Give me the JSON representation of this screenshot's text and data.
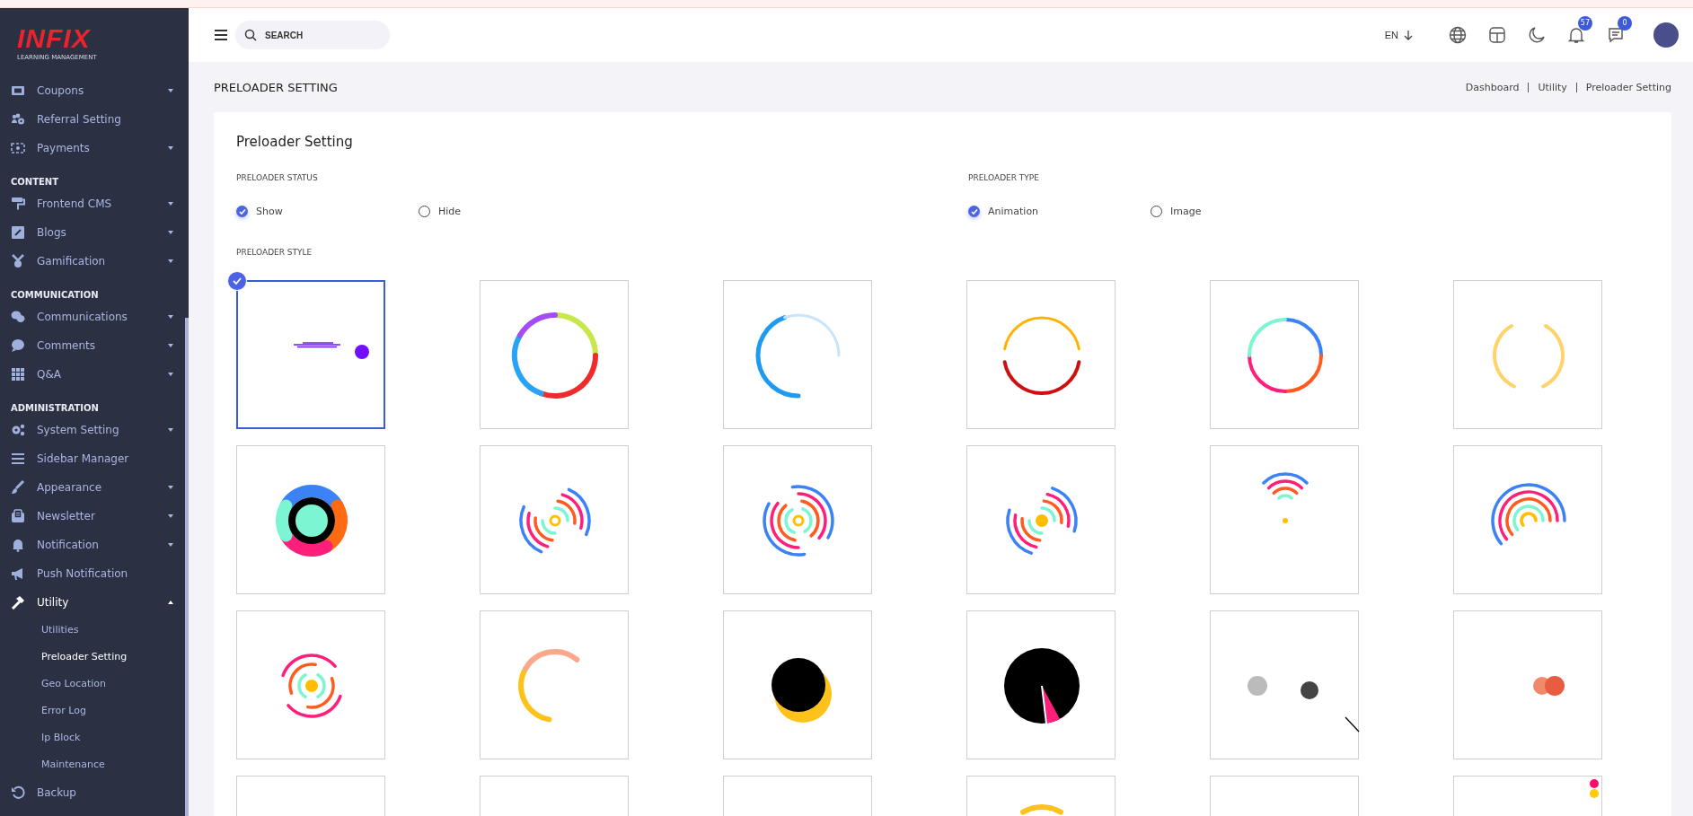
{
  "logo": {
    "wordmark": "INFIX",
    "tagline": "LEARNING MANAGEMENT"
  },
  "sidebar": {
    "sections": [
      {
        "items": [
          {
            "label": "Coupons",
            "expanded": false
          },
          {
            "label": "Referral Setting"
          },
          {
            "label": "Payments",
            "expanded": false
          }
        ]
      },
      {
        "title": "CONTENT",
        "items": [
          {
            "label": "Frontend CMS",
            "expanded": false
          },
          {
            "label": "Blogs",
            "expanded": false
          },
          {
            "label": "Gamification",
            "expanded": false
          }
        ]
      },
      {
        "title": "COMMUNICATION",
        "items": [
          {
            "label": "Communications",
            "expanded": false
          },
          {
            "label": "Comments",
            "expanded": false
          },
          {
            "label": "Q&A",
            "expanded": false
          }
        ]
      },
      {
        "title": "ADMINISTRATION",
        "items": [
          {
            "label": "System Setting",
            "expanded": false
          },
          {
            "label": "Sidebar Manager"
          },
          {
            "label": "Appearance",
            "expanded": false
          },
          {
            "label": "Newsletter",
            "expanded": false
          },
          {
            "label": "Notification",
            "expanded": false
          },
          {
            "label": "Push Notification"
          },
          {
            "label": "Utility",
            "expanded": true,
            "children": [
              {
                "label": "Utilities",
                "selected": false
              },
              {
                "label": "Preloader Setting",
                "selected": true
              },
              {
                "label": "Geo Location",
                "selected": false
              },
              {
                "label": "Error Log",
                "selected": false
              },
              {
                "label": "Ip Block",
                "selected": false
              },
              {
                "label": "Maintenance",
                "selected": false
              }
            ]
          },
          {
            "label": "Backup"
          }
        ]
      }
    ]
  },
  "header": {
    "search": {
      "placeholder": "SEARCH"
    },
    "language": "EN",
    "notifications_badge": "57",
    "messages_badge": "0"
  },
  "page": {
    "title": "PRELOADER SETTING",
    "breadcrumb": [
      "Dashboard",
      "Utility",
      "Preloader Setting"
    ]
  },
  "card": {
    "title": "Preloader Setting",
    "groups": [
      {
        "label": "PRELOADER STATUS",
        "options": [
          {
            "label": "Show",
            "selected": true
          },
          {
            "label": "Hide",
            "selected": false
          }
        ]
      },
      {
        "label": "PRELOADER TYPE",
        "options": [
          {
            "label": "Animation",
            "selected": true
          },
          {
            "label": "Image",
            "selected": false
          }
        ]
      }
    ],
    "style_label": "PRELOADER STYLE",
    "styles": [
      {
        "kind": "dash-blob",
        "selected": true
      },
      {
        "kind": "ring-rainbow",
        "selected": false
      },
      {
        "kind": "ring-blue",
        "selected": false
      },
      {
        "kind": "ring-sunset",
        "selected": false
      },
      {
        "kind": "ring-neon",
        "selected": false
      },
      {
        "kind": "arc-pair",
        "selected": false
      },
      {
        "kind": "donut",
        "selected": false
      },
      {
        "kind": "arcs-twin",
        "selected": false
      },
      {
        "kind": "arcs-ring",
        "selected": false
      },
      {
        "kind": "arcs-twin-dot",
        "selected": false
      },
      {
        "kind": "arcs-fan",
        "selected": false
      },
      {
        "kind": "arcs-rainbow",
        "selected": false
      },
      {
        "kind": "arcs-orbit",
        "selected": false
      },
      {
        "kind": "arc-single",
        "selected": false
      },
      {
        "kind": "eclipse",
        "selected": false
      },
      {
        "kind": "pie-clock",
        "selected": false
      },
      {
        "kind": "dots-gray",
        "selected": false
      },
      {
        "kind": "dots-orange",
        "selected": false
      },
      {
        "kind": "blank",
        "selected": false
      },
      {
        "kind": "blank",
        "selected": false
      },
      {
        "kind": "blank",
        "selected": false
      },
      {
        "kind": "arc-bottom",
        "selected": false
      },
      {
        "kind": "blank",
        "selected": false
      },
      {
        "kind": "dots-corner",
        "selected": false
      }
    ]
  }
}
